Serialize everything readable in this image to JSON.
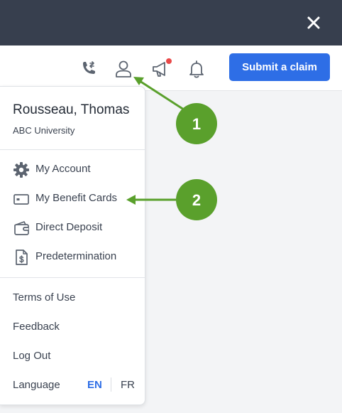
{
  "header": {
    "close_icon": "close-icon"
  },
  "navbar": {
    "icons": [
      "phone-transfer-icon",
      "user-profile-icon",
      "megaphone-icon",
      "bell-icon"
    ],
    "submit_label": "Submit a claim",
    "colors": {
      "accent": "#2e6ee6",
      "topbar": "#373f4e",
      "notification_dot": "#e94848"
    }
  },
  "dropdown": {
    "user_name": "Rousseau, Thomas",
    "organization": "ABC University",
    "items": [
      {
        "label": "My Account",
        "icon": "gear-icon"
      },
      {
        "label": "My Benefit Cards",
        "icon": "card-icon"
      },
      {
        "label": "Direct Deposit",
        "icon": "wallet-icon"
      },
      {
        "label": "Predetermination",
        "icon": "document-dollar-icon"
      }
    ],
    "links": [
      {
        "label": "Terms of Use"
      },
      {
        "label": "Feedback"
      },
      {
        "label": "Log Out"
      }
    ],
    "language": {
      "label": "Language",
      "options": [
        "EN",
        "FR"
      ],
      "selected": "EN"
    }
  },
  "annotations": {
    "color": "#5aa02c",
    "badges": [
      "1",
      "2"
    ]
  }
}
